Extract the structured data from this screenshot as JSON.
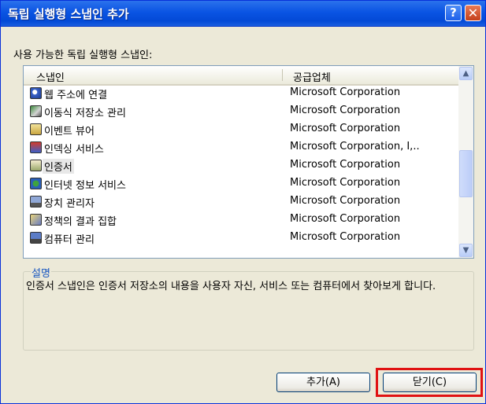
{
  "window": {
    "title": "독립 실행형 스냅인 추가"
  },
  "titlebar": {
    "help_glyph": "?",
    "close_glyph": "✕"
  },
  "available_label": "사용 가능한 독립 실행형 스냅인:",
  "list": {
    "columns": [
      "스냅인",
      "공급업체"
    ],
    "rows": [
      {
        "name": "웹 주소에 연결",
        "vendor": "Microsoft Corporation",
        "icon": "web-link-icon"
      },
      {
        "name": "이동식 저장소 관리",
        "vendor": "Microsoft Corporation",
        "icon": "removable-storage-icon"
      },
      {
        "name": "이벤트 뷰어",
        "vendor": "Microsoft Corporation",
        "icon": "event-viewer-icon"
      },
      {
        "name": "인덱싱 서비스",
        "vendor": "Microsoft Corporation, I,..",
        "icon": "indexing-service-icon"
      },
      {
        "name": "인증서",
        "vendor": "Microsoft Corporation",
        "icon": "certificate-icon",
        "selected": true
      },
      {
        "name": "인터넷 정보 서비스",
        "vendor": "Microsoft Corporation",
        "icon": "iis-icon"
      },
      {
        "name": "장치 관리자",
        "vendor": "Microsoft Corporation",
        "icon": "device-manager-icon"
      },
      {
        "name": "정책의 결과 집합",
        "vendor": "Microsoft Corporation",
        "icon": "rsop-icon"
      },
      {
        "name": "컴퓨터 관리",
        "vendor": "Microsoft Corporation",
        "icon": "computer-management-icon"
      }
    ]
  },
  "scrollbar": {
    "up_glyph": "▲",
    "down_glyph": "▼"
  },
  "description": {
    "label": "설명",
    "text": "인증서 스냅인은 인증서 저장소의 내용을 사용자 자신, 서비스 또는 컴퓨터에서 찾아보게 합니다."
  },
  "buttons": {
    "add": "추가(A)",
    "close": "닫기(C)"
  },
  "colors": {
    "titlebar": "#0a54e3",
    "window_bg": "#ece9d8",
    "highlight": "#e01212",
    "group_label": "#1554c0"
  }
}
